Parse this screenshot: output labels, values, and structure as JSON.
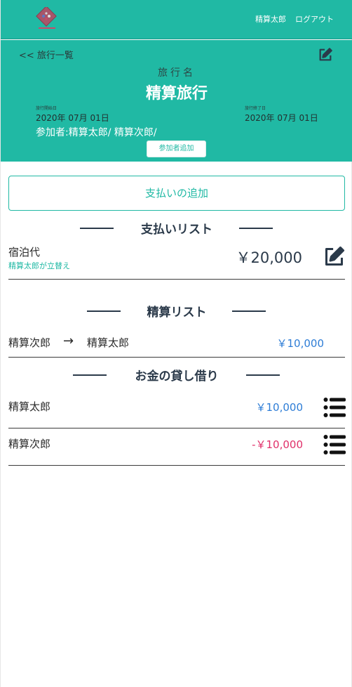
{
  "nav": {
    "user": "精算太郎",
    "logout": "ログアウト"
  },
  "trip": {
    "back": "<< 旅行一覧",
    "label": "旅行名",
    "name": "精算旅行",
    "start_caption": "旅行開始日",
    "start_date": "2020年 07月 01日",
    "end_caption": "旅行終了日",
    "end_date": "2020年 07月 01日",
    "members": "参加者:精算太郎/ 精算次郎/",
    "add_member": "参加者追加"
  },
  "add_payment": "支払いの追加",
  "payments": {
    "title": "支払いリスト",
    "items": [
      {
        "title": "宿泊代",
        "payer": "精算太郎が立替え",
        "amount": "￥20,000"
      }
    ]
  },
  "settlements": {
    "title": "精算リスト",
    "items": [
      {
        "from": "精算次郎",
        "arrow": "→",
        "to": "精算太郎",
        "amount": "￥10,000"
      }
    ]
  },
  "balances": {
    "title": "お金の貸し借り",
    "items": [
      {
        "name": "精算太郎",
        "amount": "￥10,000",
        "color": "#2e7dd6"
      },
      {
        "name": "精算次郎",
        "amount": "-￥10,000",
        "color": "#e0306a"
      }
    ]
  },
  "colors": {
    "accent": "#20b9a4",
    "heading": "#2b3a4a",
    "positive": "#2e7dd6",
    "negative": "#e0306a"
  },
  "icons": {
    "logo": "dice-logo",
    "edit": "edit-icon",
    "list": "list-icon"
  }
}
